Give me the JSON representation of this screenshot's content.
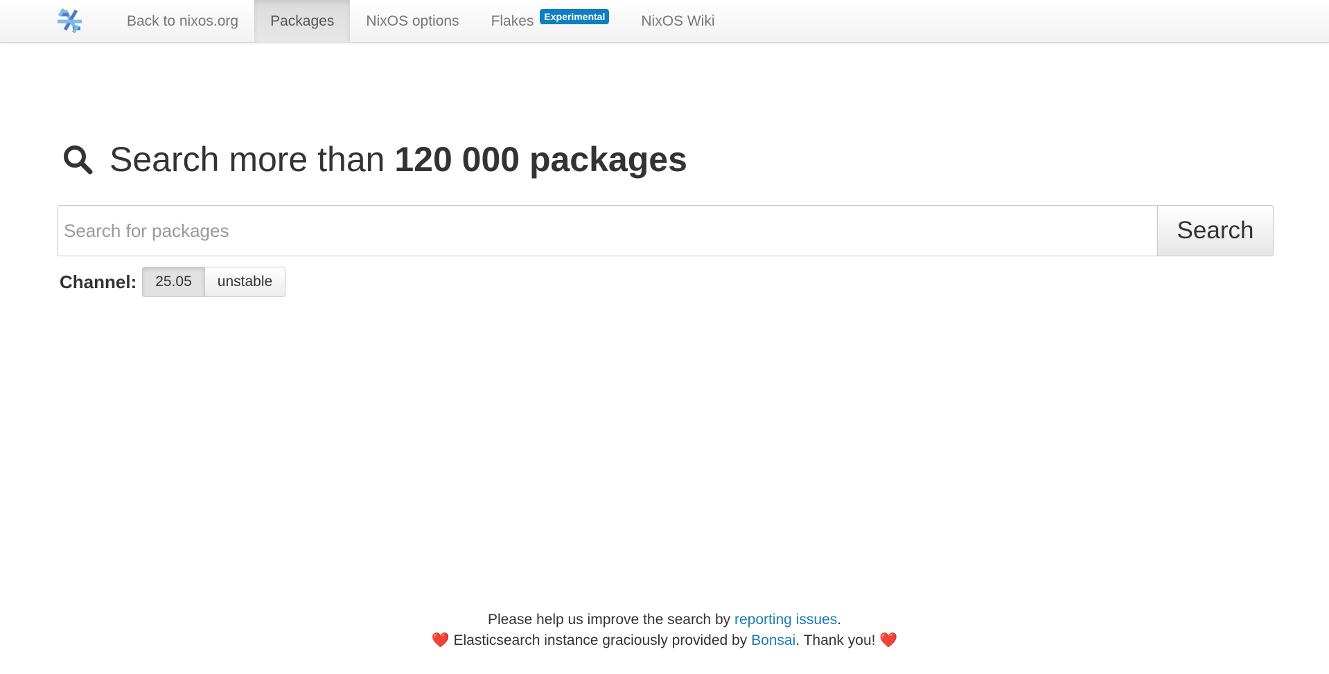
{
  "nav": {
    "logo_icon": "nixos-snowflake-icon",
    "items": [
      {
        "label": "Back to nixos.org",
        "active": false
      },
      {
        "label": "Packages",
        "active": true
      },
      {
        "label": "NixOS options",
        "active": false
      },
      {
        "label": "Flakes",
        "active": false,
        "badge": "Experimental"
      },
      {
        "label": "NixOS Wiki",
        "active": false
      }
    ]
  },
  "heading": {
    "icon": "search-icon",
    "prefix": "Search more than ",
    "emphasis": "120 000 packages"
  },
  "search": {
    "placeholder": "Search for packages",
    "value": "",
    "button_label": "Search"
  },
  "channel": {
    "label": "Channel:",
    "options": [
      "25.05",
      "unstable"
    ],
    "selected": "25.05"
  },
  "footer": {
    "line1_prefix": "Please help us improve the search by ",
    "line1_link": "reporting issues",
    "line1_suffix": ".",
    "heart": "❤️",
    "line2_prefix": " Elasticsearch instance graciously provided by ",
    "line2_link": "Bonsai",
    "line2_suffix": ". Thank you! "
  },
  "colors": {
    "badge": "#0e7fc0",
    "link": "#1c7ab8",
    "heart": "#dd2e44",
    "nixos_blue_dark": "#5277c3",
    "nixos_blue_light": "#7ebae4"
  }
}
